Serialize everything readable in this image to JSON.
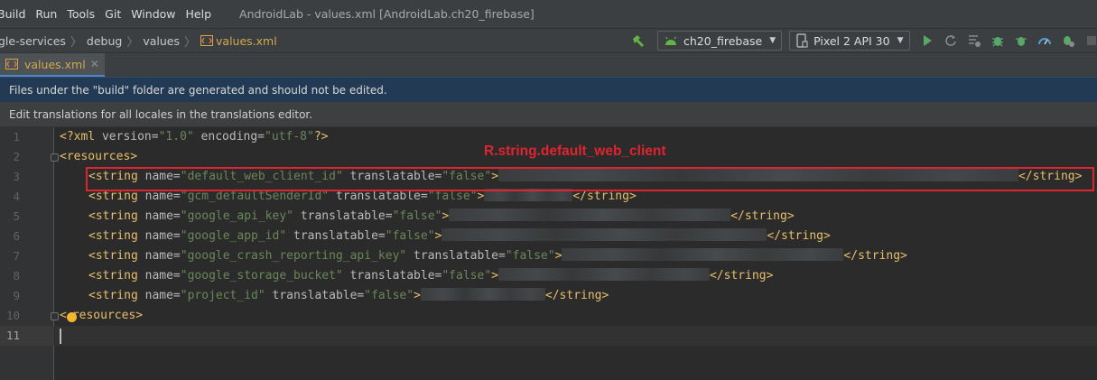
{
  "menu": {
    "items": [
      "Build",
      "Run",
      "Tools",
      "Git",
      "Window",
      "Help"
    ],
    "window_title": "AndroidLab - values.xml [AndroidLab.ch20_firebase]"
  },
  "nav": {
    "breadcrumbs": [
      "gle-services",
      "debug",
      "values"
    ],
    "file": "values.xml",
    "run_config": "ch20_firebase",
    "device": "Pixel 2 API 30"
  },
  "tab": {
    "label": "values.xml"
  },
  "banners": {
    "generated_warning": "Files under the \"build\" folder are generated and should not be edited.",
    "translations": "Edit translations for all locales in the translations editor."
  },
  "annotation": "R.string.default_web_client",
  "editor": {
    "line_numbers": [
      "1",
      "2",
      "3",
      "4",
      "5",
      "6",
      "7",
      "8",
      "9",
      "10",
      "11"
    ],
    "xml_decl": {
      "open": "<?xml",
      "version_attr": " version=",
      "version_val": "\"1.0\"",
      "enc_attr": " encoding=",
      "enc_val": "\"utf-8\"",
      "close": "?>"
    },
    "resources_open": "<resources>",
    "resources_close": "resources>",
    "resources_close_prefix": "<",
    "string_open": "<string",
    "string_close": "</string>",
    "name_attr": " name=",
    "translatable_attr": " translatable=",
    "translatable_val": "\"false\"",
    "gt": ">",
    "strings": [
      {
        "name": "\"default_web_client_id\""
      },
      {
        "name": "\"gcm_defaultSenderId\""
      },
      {
        "name": "\"google_api_key\""
      },
      {
        "name": "\"google_app_id\""
      },
      {
        "name": "\"google_crash_reporting_api_key\""
      },
      {
        "name": "\"google_storage_bucket\""
      },
      {
        "name": "\"project_id\""
      }
    ]
  },
  "icons": {
    "build": "hammer-icon",
    "run_config": "android-icon",
    "device": "device-icon",
    "run": "play-icon",
    "debug": "bug-icon",
    "stop": "stop-icon"
  },
  "colors": {
    "tag": "#e8bf6a",
    "value": "#6a8759",
    "highlight": "#e0242f",
    "banner": "#233a54"
  }
}
